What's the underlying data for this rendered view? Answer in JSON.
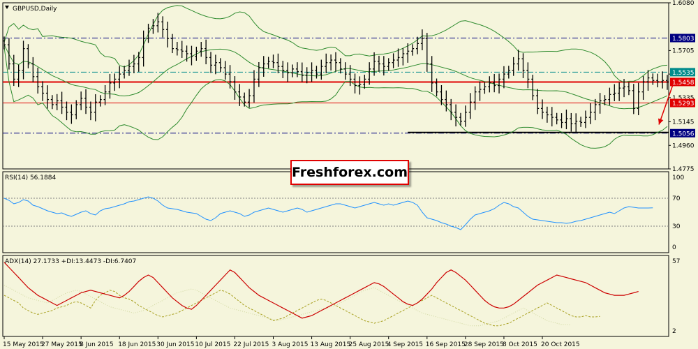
{
  "chart_data": [
    {
      "type": "candlestick",
      "panel": "price",
      "title": "GBPUSD,Daily",
      "colors": {
        "bars": "#000000",
        "bollinger": "#2E8B2E",
        "support_resistance": "#E00000",
        "arrow": "#E00000"
      },
      "ylim": [
        1.4775,
        1.608
      ],
      "y_ticks": [
        1.608,
        1.5705,
        1.552,
        1.5335,
        1.5145,
        1.496,
        1.4775
      ],
      "x_ticks": [
        "15 May 2015",
        "27 May 2015",
        "8 Jun 2015",
        "18 Jun 2015",
        "30 Jun 2015",
        "10 Jul 2015",
        "22 Jul 2015",
        "3 Aug 2015",
        "13 Aug 2015",
        "25 Aug 2015",
        "4 Sep 2015",
        "16 Sep 2015",
        "28 Sep 2015",
        "8 Oct 2015",
        "20 Oct 2015"
      ],
      "x_tick_index": [
        0,
        8,
        16,
        24,
        32,
        40,
        48,
        56,
        64,
        72,
        80,
        88,
        96,
        104,
        112
      ],
      "close": [
        1.575,
        1.56,
        1.548,
        1.555,
        1.572,
        1.56,
        1.55,
        1.542,
        1.537,
        1.532,
        1.528,
        1.531,
        1.526,
        1.522,
        1.52,
        1.528,
        1.533,
        1.526,
        1.522,
        1.53,
        1.532,
        1.538,
        1.545,
        1.548,
        1.552,
        1.555,
        1.558,
        1.56,
        1.565,
        1.58,
        1.588,
        1.59,
        1.593,
        1.587,
        1.58,
        1.572,
        1.571,
        1.57,
        1.568,
        1.566,
        1.57,
        1.572,
        1.565,
        1.559,
        1.561,
        1.557,
        1.552,
        1.546,
        1.538,
        1.534,
        1.53,
        1.535,
        1.548,
        1.557,
        1.56,
        1.562,
        1.561,
        1.558,
        1.555,
        1.553,
        1.556,
        1.554,
        1.551,
        1.553,
        1.555,
        1.552,
        1.558,
        1.561,
        1.563,
        1.561,
        1.556,
        1.552,
        1.548,
        1.543,
        1.544,
        1.548,
        1.556,
        1.562,
        1.56,
        1.558,
        1.561,
        1.563,
        1.565,
        1.568,
        1.57,
        1.572,
        1.576,
        1.58,
        1.56,
        1.545,
        1.538,
        1.532,
        1.528,
        1.522,
        1.518,
        1.515,
        1.522,
        1.53,
        1.538,
        1.54,
        1.542,
        1.545,
        1.543,
        1.548,
        1.552,
        1.555,
        1.56,
        1.564,
        1.555,
        1.548,
        1.535,
        1.525,
        1.522,
        1.52,
        1.518,
        1.516,
        1.514,
        1.517,
        1.513,
        1.515,
        1.514,
        1.518,
        1.522,
        1.528,
        1.531,
        1.532,
        1.536,
        1.537,
        1.541,
        1.542,
        1.539,
        1.525,
        1.538,
        1.546,
        1.549,
        1.547,
        1.546,
        1.547,
        1.5458
      ],
      "hlines": [
        {
          "value": 1.5803,
          "label": "1.5803",
          "style": "dashdot-navy"
        },
        {
          "value": 1.5535,
          "label": "1.5535",
          "style": "dashdot-teal"
        },
        {
          "value": 1.5458,
          "label": "1.5458",
          "style": "solid-red-thick"
        },
        {
          "value": 1.5293,
          "label": "1.5293",
          "style": "solid-red"
        },
        {
          "value": 1.5056,
          "label": "1.5056",
          "style": "dashdot-navy"
        }
      ],
      "indicator": "Bollinger Bands"
    },
    {
      "type": "line",
      "panel": "rsi",
      "title": "RSI(14) 56.1884",
      "color": "#1E90FF",
      "ylim": [
        0,
        100
      ],
      "y_ticks": [
        100,
        70,
        30,
        0
      ],
      "levels": [
        70,
        30
      ],
      "values": [
        70,
        67,
        62,
        64,
        68,
        66,
        60,
        58,
        55,
        52,
        50,
        48,
        49,
        46,
        44,
        47,
        50,
        52,
        48,
        46,
        52,
        55,
        56,
        58,
        60,
        62,
        65,
        66,
        68,
        70,
        72,
        70,
        66,
        60,
        56,
        55,
        54,
        52,
        50,
        49,
        48,
        44,
        40,
        38,
        42,
        48,
        50,
        52,
        50,
        48,
        44,
        46,
        50,
        52,
        54,
        56,
        54,
        52,
        50,
        52,
        54,
        56,
        54,
        50,
        52,
        54,
        56,
        58,
        60,
        62,
        62,
        60,
        58,
        56,
        58,
        60,
        62,
        64,
        62,
        60,
        62,
        60,
        62,
        64,
        66,
        64,
        60,
        50,
        42,
        40,
        38,
        35,
        33,
        30,
        28,
        25,
        32,
        40,
        46,
        48,
        50,
        52,
        55,
        60,
        64,
        62,
        58,
        56,
        50,
        44,
        40,
        39,
        38,
        37,
        36,
        35,
        35,
        34,
        35,
        37,
        38,
        40,
        42,
        44,
        46,
        48,
        50,
        48,
        52,
        56,
        58,
        57,
        56,
        56,
        56,
        56.1884
      ]
    },
    {
      "type": "line",
      "panel": "adx",
      "title": "ADX(14) 27.1733 +DI:13.4473 -DI:6.7407",
      "colors": {
        "adx": "#CC0000",
        "plus_di": "#A8A020",
        "minus_di": "#D0D8A0"
      },
      "ylim": [
        2,
        57
      ],
      "y_ticks": [
        57,
        2
      ],
      "series": [
        {
          "name": "ADX",
          "values": [
            56,
            52,
            48,
            44,
            40,
            36,
            33,
            30,
            28,
            26,
            24,
            22,
            24,
            26,
            28,
            30,
            32,
            33,
            34,
            33,
            32,
            31,
            30,
            29,
            28,
            30,
            33,
            37,
            41,
            44,
            46,
            44,
            40,
            36,
            32,
            28,
            25,
            22,
            20,
            19,
            22,
            26,
            30,
            34,
            38,
            42,
            46,
            50,
            48,
            44,
            40,
            36,
            33,
            30,
            28,
            26,
            24,
            22,
            20,
            18,
            16,
            14,
            12,
            13,
            14,
            16,
            18,
            20,
            22,
            24,
            26,
            28,
            30,
            32,
            34,
            36,
            38,
            40,
            39,
            37,
            34,
            31,
            28,
            25,
            23,
            22,
            24,
            27,
            31,
            35,
            40,
            44,
            48,
            50,
            48,
            45,
            42,
            38,
            34,
            30,
            26,
            23,
            21,
            20,
            20,
            21,
            23,
            26,
            29,
            32,
            35,
            38,
            40,
            42,
            44,
            46,
            45,
            44,
            43,
            42,
            41,
            40,
            38,
            36,
            34,
            32,
            31,
            30,
            30,
            30,
            31,
            32,
            33
          ]
        },
        {
          "name": "+DI",
          "values": [
            30,
            28,
            26,
            24,
            20,
            18,
            16,
            15,
            16,
            17,
            18,
            20,
            21,
            22,
            24,
            25,
            24,
            22,
            20,
            26,
            30,
            32,
            34,
            33,
            30,
            28,
            27,
            25,
            22,
            20,
            18,
            16,
            14,
            13,
            14,
            15,
            16,
            18,
            20,
            22,
            24,
            26,
            28,
            30,
            32,
            34,
            33,
            31,
            28,
            25,
            22,
            20,
            18,
            16,
            14,
            12,
            10,
            11,
            12,
            14,
            16,
            18,
            20,
            22,
            24,
            26,
            27,
            26,
            24,
            22,
            20,
            18,
            16,
            14,
            12,
            10,
            9,
            8,
            9,
            10,
            12,
            14,
            16,
            18,
            20,
            22,
            24,
            26,
            28,
            30,
            28,
            26,
            24,
            22,
            20,
            18,
            16,
            14,
            12,
            10,
            8,
            7,
            6,
            6,
            7,
            8,
            10,
            12,
            14,
            16,
            18,
            20,
            22,
            24,
            22,
            20,
            18,
            16,
            14,
            13,
            13,
            14,
            13,
            13,
            13.4473
          ]
        },
        {
          "name": "-DI",
          "values": [
            38,
            36,
            34,
            32,
            30,
            28,
            27,
            26,
            25,
            24,
            26,
            28,
            30,
            32,
            33,
            34,
            33,
            31,
            29,
            27,
            25,
            23,
            21,
            20,
            19,
            18,
            17,
            16,
            17,
            18,
            20,
            22,
            24,
            26,
            28,
            30,
            32,
            33,
            34,
            35,
            34,
            32,
            30,
            28,
            26,
            24,
            22,
            20,
            19,
            18,
            17,
            16,
            15,
            14,
            13,
            12,
            11,
            10,
            11,
            12,
            13,
            14,
            15,
            16,
            17,
            18,
            19,
            20,
            21,
            22,
            24,
            26,
            28,
            30,
            32,
            34,
            35,
            36,
            34,
            32,
            30,
            28,
            26,
            24,
            22,
            20,
            18,
            16,
            15,
            14,
            13,
            12,
            11,
            10,
            9,
            8,
            7,
            6,
            6,
            6,
            7,
            8,
            9,
            10,
            12,
            14,
            16,
            18,
            20,
            18,
            16,
            14,
            12,
            10,
            9,
            8,
            7,
            7,
            6.7407
          ]
        }
      ]
    }
  ],
  "watermark": {
    "text": "Freshforex.com"
  }
}
